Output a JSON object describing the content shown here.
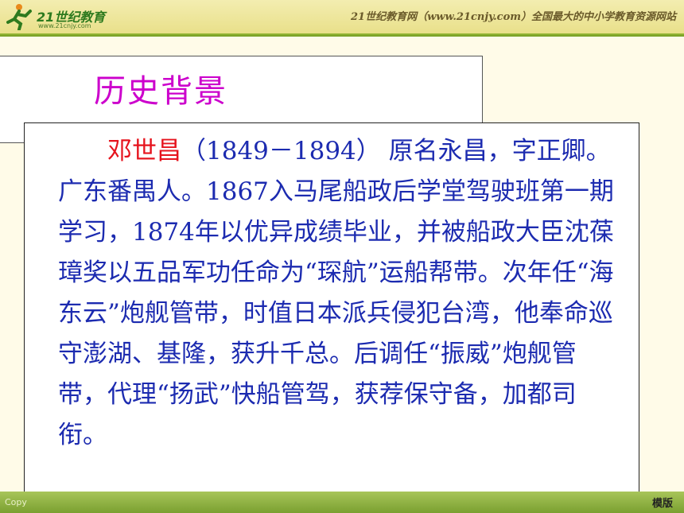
{
  "header": {
    "logo_text": "21世纪教育",
    "logo_url": "www.21cnjy.com",
    "slogan": "21世纪教育网（www.21cnjy.com）全国最大的中小学教育资源网站"
  },
  "slide": {
    "title": "历史背景",
    "name": "邓世昌",
    "body": "（1849－1894） 原名永昌，字正卿。广东番禺人。1867入马尾船政后学堂驾驶班第一期学习，1874年以优异成绩毕业，并被船政大臣沈葆璋奖以五品军功任命为“琛航”运船帮带。次年任“海东云”炮舰管带，时值日本派兵侵犯台湾，他奉命巡守澎湖、基隆，获升千总。后调任“振威”炮舰管带，代理“扬武”快船管驾，获荐保守备，加都司衔。"
  },
  "footer": {
    "left": "Copy",
    "right": "模版"
  },
  "colors": {
    "title": "#cc00cc",
    "name": "#e6141e",
    "body": "#1c2bb0"
  }
}
